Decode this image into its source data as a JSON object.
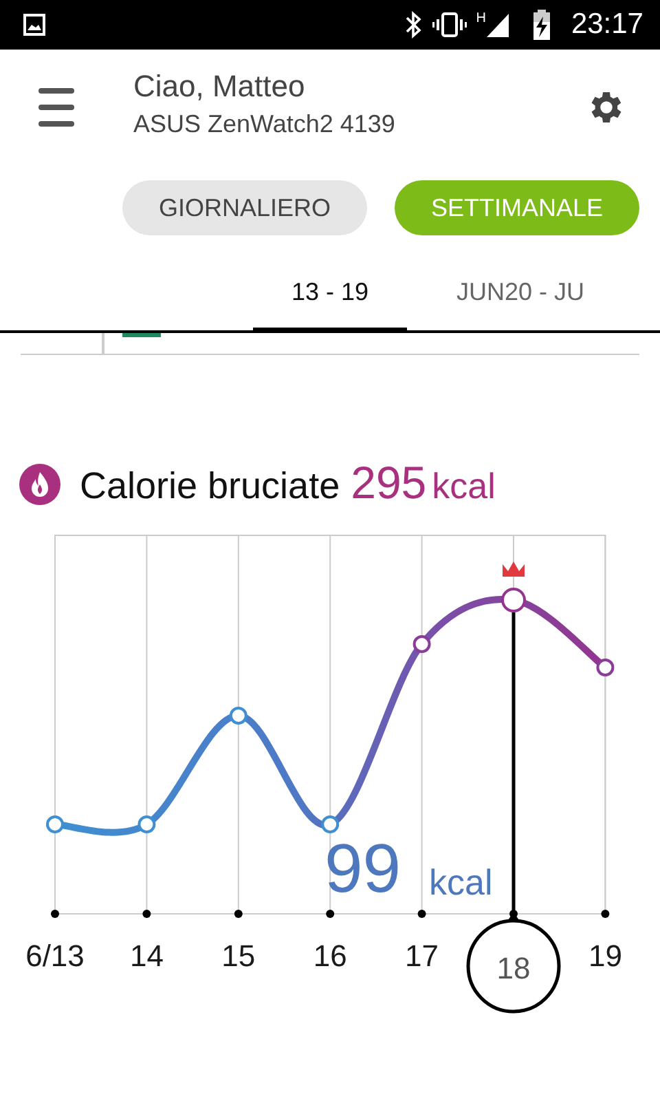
{
  "status_bar": {
    "network_type": "H",
    "time": "23:17"
  },
  "header": {
    "greeting": "Ciao, Matteo",
    "device": "ASUS ZenWatch2 4139"
  },
  "period_toggle": [
    {
      "label": "GIORNALIERO",
      "selected": false
    },
    {
      "label": "SETTIMANALE",
      "selected": true
    }
  ],
  "week_tabs": [
    {
      "label": "13 - 19",
      "selected": true
    },
    {
      "label": "JUN20 - JU",
      "selected": false
    }
  ],
  "calories": {
    "title": "Calorie bruciate",
    "total": "295",
    "total_unit": "kcal",
    "reading": "99",
    "reading_unit": "kcal",
    "days": [
      {
        "label": "6/13",
        "selected": false
      },
      {
        "label": "14",
        "selected": false
      },
      {
        "label": "15",
        "selected": false
      },
      {
        "label": "16",
        "selected": false
      },
      {
        "label": "17",
        "selected": false
      },
      {
        "label": "18",
        "selected": true
      },
      {
        "label": "19",
        "selected": false
      }
    ]
  }
}
